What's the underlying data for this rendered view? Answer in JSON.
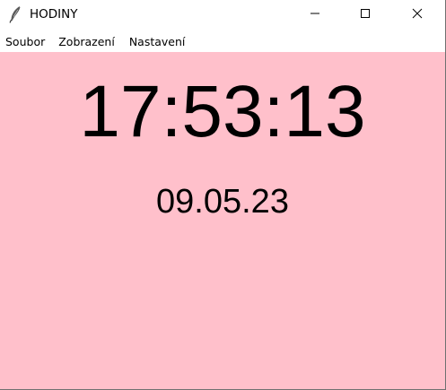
{
  "window": {
    "title": "HODINY",
    "app_icon": "feather-icon",
    "controls": {
      "minimize_icon": "minimize-icon",
      "maximize_icon": "maximize-icon",
      "close_icon": "close-icon"
    }
  },
  "menu": {
    "items": [
      "Soubor",
      "Zobrazení",
      "Nastavení"
    ]
  },
  "clock": {
    "time": "17:53:13",
    "date": "09.05.23",
    "background_color": "#ffc0cb",
    "text_color": "#000000"
  }
}
